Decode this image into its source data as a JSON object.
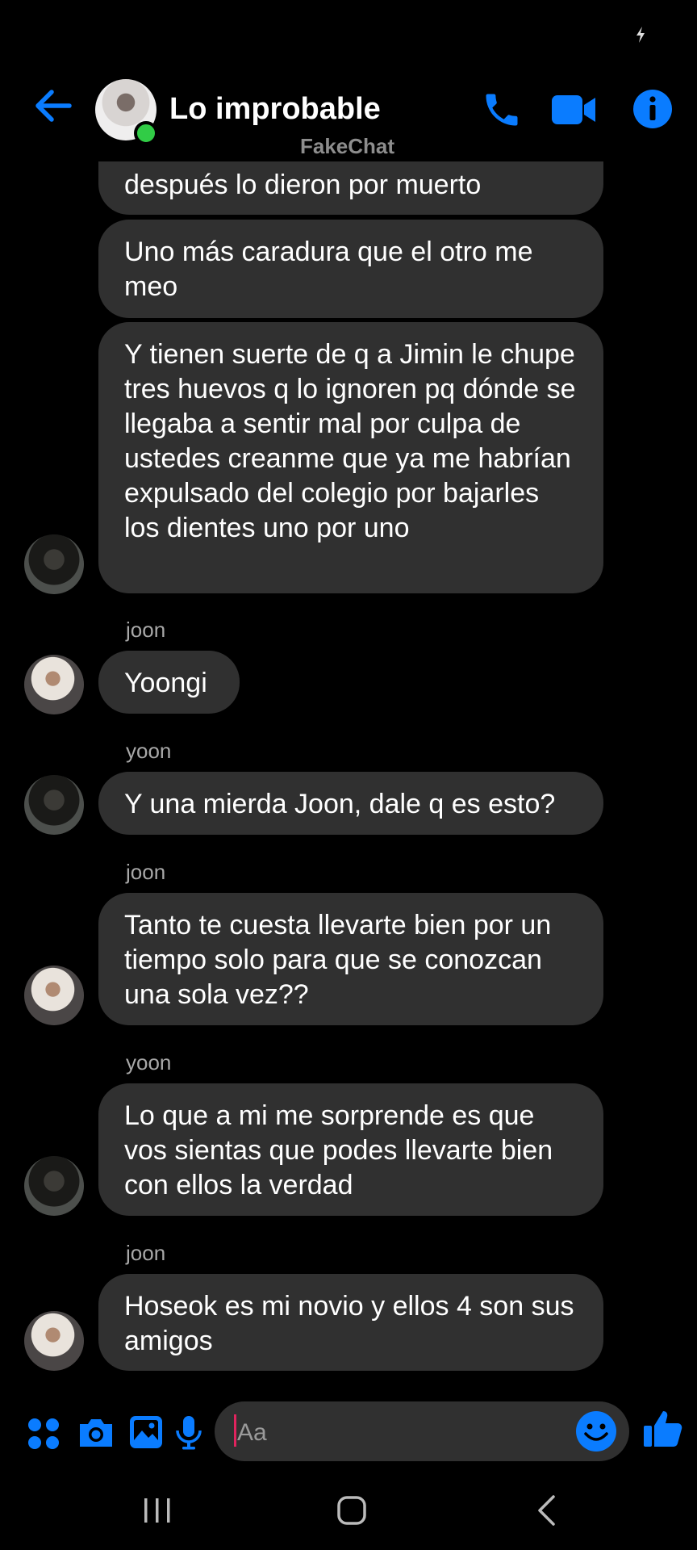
{
  "header": {
    "title": "Lo improbable",
    "watermark": "FakeChat"
  },
  "colors": {
    "accent": "#0a7cff",
    "bubble": "#303030",
    "online": "#31cc46"
  },
  "icons": {
    "back": "back-arrow-icon",
    "call": "phone-icon",
    "video": "video-camera-icon",
    "info": "info-icon",
    "apps": "apps-grid-icon",
    "camera": "camera-icon",
    "gallery": "gallery-icon",
    "mic": "microphone-icon",
    "emoji": "emoji-icon",
    "like": "thumbs-up-icon"
  },
  "messages": [
    {
      "sender": "",
      "text": "después lo dieron por muerto"
    },
    {
      "sender": "",
      "text": "Uno más caradura que el otro me meo"
    },
    {
      "sender": "",
      "text": "Y tienen suerte de q a Jimin le chupe tres huevos q lo ignoren pq dónde se llegaba a sentir mal por culpa de ustedes creanme que ya me habrían expulsado del colegio por bajarles los dientes uno por uno"
    },
    {
      "sender": "joon",
      "text": "Yoongi"
    },
    {
      "sender": "yoon",
      "text": "Y una mierda Joon, dale q es esto?"
    },
    {
      "sender": "joon",
      "text": "Tanto te cuesta llevarte bien por un tiempo solo para que se conozcan una sola vez??"
    },
    {
      "sender": "yoon",
      "text": "Lo que a mi me sorprende es que vos sientas que podes llevarte bien con ellos la verdad"
    },
    {
      "sender": "joon",
      "text": "Hoseok es mi novio y ellos 4 son sus amigos"
    }
  ],
  "composer": {
    "placeholder": "Aa"
  }
}
